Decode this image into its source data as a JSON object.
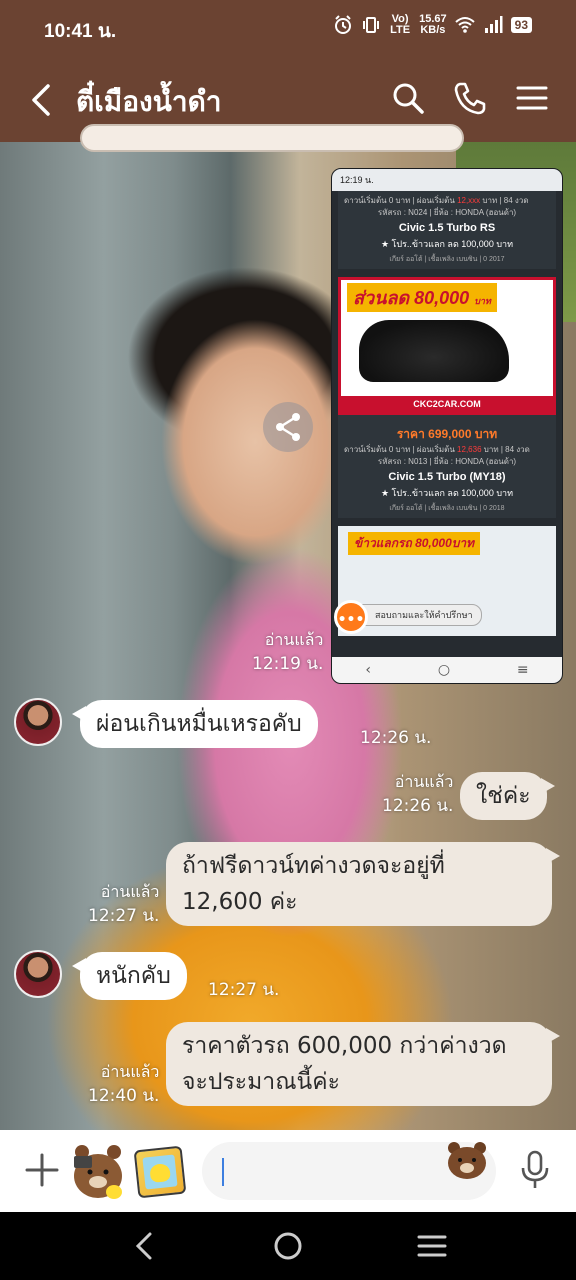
{
  "status_bar": {
    "time": "10:41 น.",
    "network_speed_value": "15.67",
    "network_speed_unit": "KB/s",
    "volte": "Vo) LTE",
    "battery": "93",
    "icons": [
      "alarm-icon",
      "vibrate-icon",
      "volte-icon",
      "wifi-icon",
      "signal-icon",
      "battery-icon"
    ]
  },
  "header": {
    "title": "ตี๋เมืองน้ำดำ",
    "icons": [
      "back-arrow-icon",
      "search-icon",
      "phone-icon",
      "menu-icon"
    ],
    "background_color": "#6b4332"
  },
  "shared_image": {
    "status_time": "12:19 น.",
    "card1": {
      "top_line_left": "ดาวน์เริ่มต้น 0 บาท",
      "top_line_mid": "ผ่อนเริ่มต้น",
      "top_line_red": "12,xxx",
      "top_line_right": "บาท | 84",
      "top_line_end": "งวด",
      "code_line": "รหัสรถ : N024 | ยี่ห้อ : HONDA (ฮอนด้า)",
      "model": "Civic 1.5 Turbo RS",
      "promo": "★ โปร..ข้าวแลก ลด 100,000 บาท",
      "meta": "เกียร์ ออโต้ | เชื้อเพลิง เบนซิน | 0 2017"
    },
    "ad1": {
      "banner_text": "ส่วนลด",
      "banner_amount": "80,000",
      "banner_unit": "บาท",
      "footer": "CKC2CAR.COM"
    },
    "card2": {
      "price": "ราคา 699,000 บาท",
      "line_left": "ดาวน์เริ่มต้น 0 บาท | ผ่อนเริ่มต้น",
      "line_red": "12,636",
      "line_right": "บาท | 84",
      "line_end": "งวด",
      "code_line": "รหัสรถ : N013 | ยี่ห้อ : HONDA (ฮอนด้า)",
      "model": "Civic 1.5 Turbo (MY18)",
      "promo": "★ โปร..ข้าวแลก ลด 100,000 บาท",
      "meta": "เกียร์ ออโต้ | เชื้อเพลิง เบนซิน | 0 2018"
    },
    "ad2": {
      "banner": "ข้าวแลกรถ 80,000บาท",
      "consult": "สอบถามและให้คำปรึกษา"
    }
  },
  "messages": [
    {
      "id": "m0",
      "direction": "out",
      "type": "image",
      "read": "อ่านแล้ว",
      "time": "12:19 น."
    },
    {
      "id": "m1",
      "direction": "in",
      "text": "ผ่อนเกินหมื่นเหรอคับ",
      "time": "12:26 น."
    },
    {
      "id": "m2",
      "direction": "out",
      "text": "ใช่ค่ะ",
      "read": "อ่านแล้ว",
      "time": "12:26 น."
    },
    {
      "id": "m3",
      "direction": "out",
      "line1": "ถ้าฟรีดาวน์ทค่างวดจะอยู่ที่",
      "line2": "12,600 ค่ะ",
      "read": "อ่านแล้ว",
      "time": "12:27 น."
    },
    {
      "id": "m4",
      "direction": "in",
      "text": "หนักคับ",
      "time": "12:27 น."
    },
    {
      "id": "m5",
      "direction": "out",
      "line1": "ราคาตัวรถ 600,000 กว่าค่างวด",
      "line2": "จะประมาณนี้ค่ะ",
      "read": "อ่านแล้ว",
      "time": "12:40 น."
    }
  ],
  "input_bar": {
    "placeholder": "",
    "icons": [
      "plus-icon",
      "brown-bear-sticker-icon",
      "gallery-icon",
      "emoji-icon",
      "mic-icon"
    ]
  },
  "nav_bar": {
    "icons": [
      "back-icon",
      "home-icon",
      "recents-icon"
    ]
  }
}
